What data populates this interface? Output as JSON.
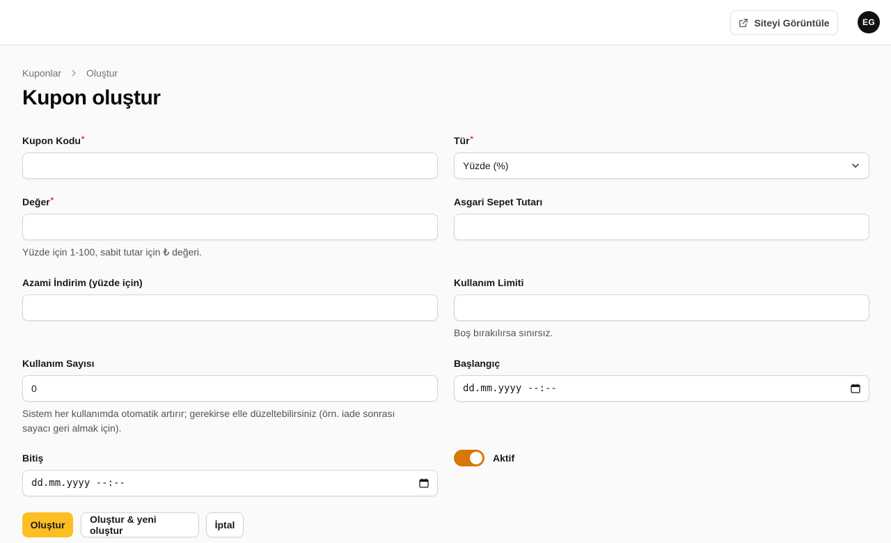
{
  "header": {
    "view_site_label": "Siteyi Görüntüle",
    "avatar_initials": "EG"
  },
  "breadcrumb": {
    "parent": "Kuponlar",
    "current": "Oluştur"
  },
  "page": {
    "title": "Kupon oluştur"
  },
  "form": {
    "coupon_code": {
      "label": "Kupon Kodu",
      "required": "*",
      "value": ""
    },
    "type": {
      "label": "Tür",
      "required": "*",
      "value": "Yüzde (%)"
    },
    "value": {
      "label": "Değer",
      "required": "*",
      "value": "",
      "hint": "Yüzde için 1-100, sabit tutar için ₺ değeri."
    },
    "min_cart": {
      "label": "Asgari Sepet Tutarı",
      "value": ""
    },
    "max_discount": {
      "label": "Azami İndirim (yüzde için)",
      "value": ""
    },
    "usage_limit": {
      "label": "Kullanım Limiti",
      "value": "",
      "hint": "Boş bırakılırsa sınırsız."
    },
    "usage_count": {
      "label": "Kullanım Sayısı",
      "value": "0",
      "hint_line1": "Sistem her kullanımda otomatik artırır; gerekirse elle düzeltebilirsiniz (örn. iade sonrası",
      "hint_line2": "sayacı geri almak için)."
    },
    "start": {
      "label": "Başlangıç",
      "placeholder": "dd.mm.yyyy --:--"
    },
    "end": {
      "label": "Bitiş",
      "placeholder": "dd.mm.yyyy --:--"
    },
    "active": {
      "label": "Aktif",
      "on": true
    }
  },
  "actions": {
    "create": "Oluştur",
    "create_another": "Oluştur & yeni oluştur",
    "cancel": "İptal"
  },
  "colors": {
    "primary": "#fbbf24",
    "toggle": "#d97706",
    "required": "#dc2626"
  }
}
